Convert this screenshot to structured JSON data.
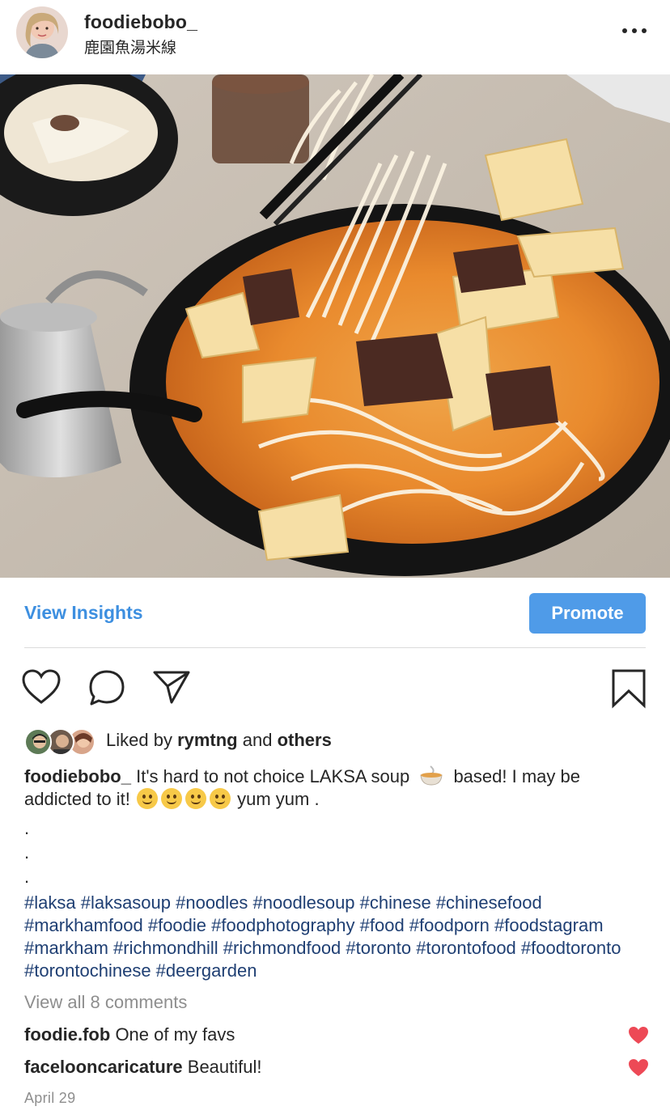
{
  "post": {
    "username": "foodiebobo_",
    "location": "鹿園魚湯米線"
  },
  "icons": {
    "more": "more-options-icon",
    "like": "heart-outline-icon",
    "comment": "comment-bubble-icon",
    "share": "paper-plane-icon",
    "save": "bookmark-icon",
    "comment_like": "heart-filled-icon"
  },
  "insights_label": "View Insights",
  "promote_label": "Promote",
  "likes": {
    "prefix": "Liked by ",
    "user": "rymtng",
    "middle": " and ",
    "others": "others"
  },
  "caption": {
    "author": "foodiebobo_",
    "text_before_emoji": " It's hard to not choice LAKSA soup",
    "text_after_emoji": "based! I may be addicted to it!",
    "text_end": "yum yum .",
    "dots": [
      ".",
      ".",
      "."
    ],
    "hashtags": "#laksa #laksasoup #noodles #noodlesoup #chinese #chinesefood #markhamfood #foodie #foodphotography #food #foodporn #foodstagram #markham #richmondhill #richmondfood #toronto #torontofood #foodtoronto #torontochinese  #deergarden"
  },
  "view_comments": "View all 8 comments",
  "comments": [
    {
      "user": "foodie.fob",
      "text": "One of my favs"
    },
    {
      "user": "facelooncaricature",
      "text": "Beautiful!"
    }
  ],
  "date": "April 29",
  "colors": {
    "link_blue": "#3d8fe0",
    "promote_bg": "#4f9be8",
    "hashtag": "#1f3f73",
    "muted": "#8e8e8e",
    "heart_red": "#ed4956"
  }
}
